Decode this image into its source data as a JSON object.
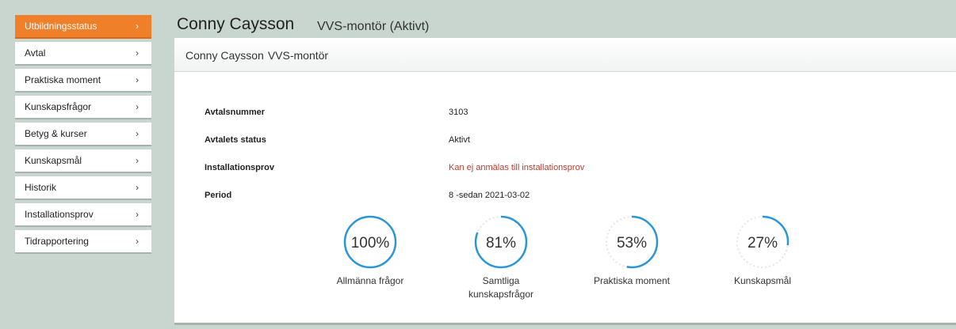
{
  "sidebar": {
    "items": [
      {
        "label": "Utbildningsstatus",
        "active": true
      },
      {
        "label": "Avtal"
      },
      {
        "label": "Praktiska moment"
      },
      {
        "label": "Kunskapsfrågor"
      },
      {
        "label": "Betyg & kurser"
      },
      {
        "label": "Kunskapsmål"
      },
      {
        "label": "Historik"
      },
      {
        "label": "Installationsprov"
      },
      {
        "label": "Tidrapportering"
      }
    ],
    "chevron": "›"
  },
  "header": {
    "name": "Conny Caysson",
    "role": "VVS-montör (Aktivt)"
  },
  "card": {
    "title_name": "Conny Caysson",
    "title_role": "VVS-montör"
  },
  "details": [
    {
      "label": "Avtalsnummer",
      "value": "3103",
      "warn": false
    },
    {
      "label": "Avtalets status",
      "value": "Aktivt",
      "warn": false
    },
    {
      "label": "Installationsprov",
      "value": "Kan ej anmälas till installationsprov",
      "warn": true
    },
    {
      "label": "Period",
      "value": "8 -sedan 2021-03-02",
      "warn": false
    }
  ],
  "progress": [
    {
      "value": 100,
      "label": "100%",
      "caption": "Allmänna frågor"
    },
    {
      "value": 81,
      "label": "81%",
      "caption": "Samtliga kunskapsfrågor"
    },
    {
      "value": 53,
      "label": "53%",
      "caption": "Praktiska moment"
    },
    {
      "value": 27,
      "label": "27%",
      "caption": "Kunskapsmål"
    }
  ],
  "colors": {
    "accent": "#f07f2a",
    "ring": "#2b95d9",
    "ring_track": "#e2e6e4",
    "warn": "#c0392b"
  }
}
